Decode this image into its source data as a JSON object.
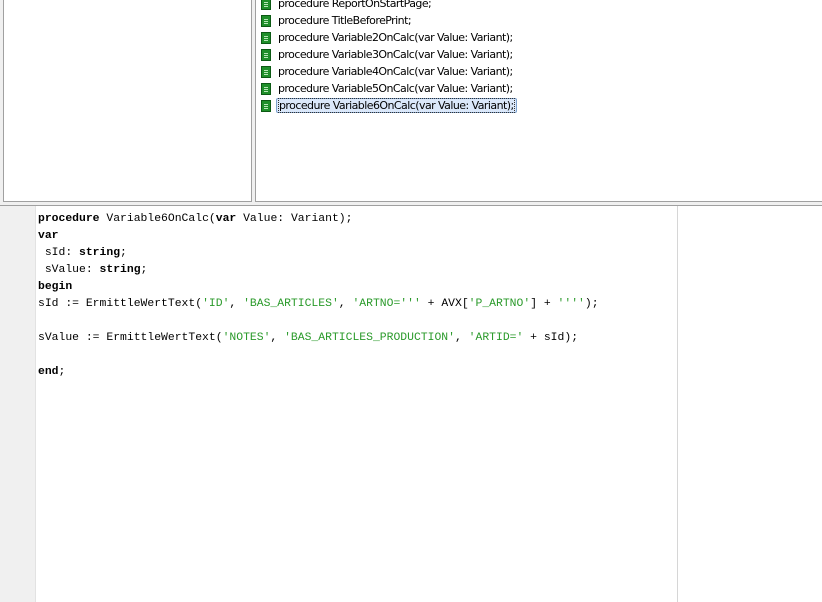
{
  "tree": {
    "items": [
      {
        "label": "procedure ReportOnStartPage;",
        "selected": false
      },
      {
        "label": "procedure TitleBeforePrint;",
        "selected": false
      },
      {
        "label": "procedure Variable2OnCalc(var Value: Variant);",
        "selected": false
      },
      {
        "label": "procedure Variable3OnCalc(var Value: Variant);",
        "selected": false
      },
      {
        "label": "procedure Variable4OnCalc(var Value: Variant);",
        "selected": false
      },
      {
        "label": "procedure Variable5OnCalc(var Value: Variant);",
        "selected": false
      },
      {
        "label": "procedure Variable6OnCalc(var Value: Variant);",
        "selected": true
      }
    ],
    "item_icon": "procedure-icon"
  },
  "editor": {
    "lines": [
      [
        {
          "t": "procedure",
          "c": "kw"
        },
        {
          "t": " Variable6OnCalc(",
          "c": ""
        },
        {
          "t": "var",
          "c": "kw"
        },
        {
          "t": " Value: Variant);",
          "c": ""
        }
      ],
      [
        {
          "t": "var",
          "c": "kw"
        }
      ],
      [
        {
          "t": " sId: ",
          "c": ""
        },
        {
          "t": "string",
          "c": "kw"
        },
        {
          "t": ";",
          "c": ""
        }
      ],
      [
        {
          "t": " sValue: ",
          "c": ""
        },
        {
          "t": "string",
          "c": "kw"
        },
        {
          "t": ";",
          "c": ""
        }
      ],
      [
        {
          "t": "begin",
          "c": "kw"
        }
      ],
      [
        {
          "t": "sId := ErmittleWertText(",
          "c": ""
        },
        {
          "t": "'ID'",
          "c": "str"
        },
        {
          "t": ", ",
          "c": ""
        },
        {
          "t": "'BAS_ARTICLES'",
          "c": "str"
        },
        {
          "t": ", ",
          "c": ""
        },
        {
          "t": "'ARTNO='''",
          "c": "str"
        },
        {
          "t": " + AVX[",
          "c": ""
        },
        {
          "t": "'P_ARTNO'",
          "c": "str"
        },
        {
          "t": "] + ",
          "c": ""
        },
        {
          "t": "''''",
          "c": "str"
        },
        {
          "t": ");",
          "c": ""
        }
      ],
      [],
      [
        {
          "t": "sValue := ErmittleWertText(",
          "c": ""
        },
        {
          "t": "'NOTES'",
          "c": "str"
        },
        {
          "t": ", ",
          "c": ""
        },
        {
          "t": "'BAS_ARTICLES_PRODUCTION'",
          "c": "str"
        },
        {
          "t": ", ",
          "c": ""
        },
        {
          "t": "'ARTID='",
          "c": "str"
        },
        {
          "t": " + sId);",
          "c": ""
        }
      ],
      [],
      [
        {
          "t": "end",
          "c": "kw"
        },
        {
          "t": ";",
          "c": ""
        }
      ]
    ],
    "colors": {
      "keyword": "#000000",
      "string": "#2a9a2a"
    }
  }
}
